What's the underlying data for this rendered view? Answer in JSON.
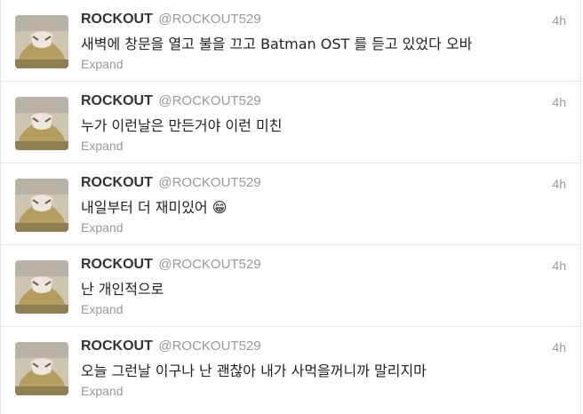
{
  "tweets": [
    {
      "name": "ROCKOUT",
      "handle": "@ROCKOUT529",
      "time": "4h",
      "text": "새벽에 창문을 열고 불을 끄고 Batman OST 를 듣고 있었다 오바",
      "expand": "Expand"
    },
    {
      "name": "ROCKOUT",
      "handle": "@ROCKOUT529",
      "time": "4h",
      "text": "누가 이런날은 만든거야 이런 미친",
      "expand": "Expand"
    },
    {
      "name": "ROCKOUT",
      "handle": "@ROCKOUT529",
      "time": "4h",
      "text": "내일부터 더 재미있어 😁",
      "expand": "Expand"
    },
    {
      "name": "ROCKOUT",
      "handle": "@ROCKOUT529",
      "time": "4h",
      "text": "난 개인적으로",
      "expand": "Expand"
    },
    {
      "name": "ROCKOUT",
      "handle": "@ROCKOUT529",
      "time": "4h",
      "text": "오늘 그런날 이구나 난 괜찮아 내가 사먹을꺼니까 말리지마",
      "expand": "Expand"
    }
  ]
}
